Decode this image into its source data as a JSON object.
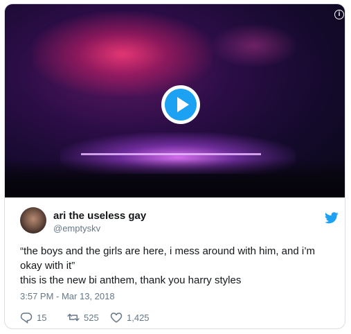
{
  "tweet": {
    "display_name": "ari the useless gay",
    "handle": "@emptyskv",
    "text_lines": [
      "“the boys and the girls are here, i mess around with him, and i’m",
      "okay with it”",
      "this is the new bi anthem, thank you harry styles"
    ],
    "timestamp": "3:57 PM - Mar 13, 2018",
    "replies": "15",
    "retweets": "525",
    "likes": "1,425"
  },
  "icons": {
    "play": "play-icon",
    "info": "info-icon",
    "brand": "twitter-bird-icon",
    "reply": "reply-icon",
    "retweet": "retweet-icon",
    "like": "heart-icon"
  },
  "colors": {
    "accent": "#1da1f2",
    "text": "#14171a",
    "muted": "#657786",
    "border": "#d9dfe4"
  }
}
